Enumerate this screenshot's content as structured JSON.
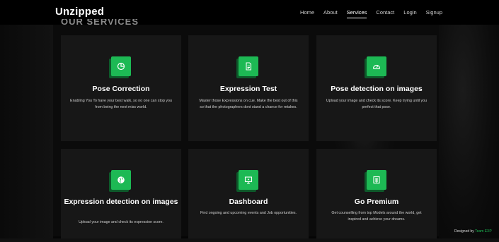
{
  "brand": "Unzipped",
  "nav": {
    "home": "Home",
    "about": "About",
    "services": "Services",
    "contact": "Contact",
    "login": "Login",
    "signup": "Signup"
  },
  "section_title": "OUR SERVICES",
  "cards": [
    {
      "title": "Pose Correction",
      "desc": "Enabling You To have your best walk, so no one can stop you from being the next miss world.",
      "icon": "chart-pie-icon"
    },
    {
      "title": "Expression Test",
      "desc": "Master those Expressions on cue. Make the best out of this so that the photographers dont stand a chance for retakes.",
      "icon": "document-icon"
    },
    {
      "title": "Pose detection on images",
      "desc": "Upload your image and check its score. Keep trying until you perfect that pose.",
      "icon": "gauge-icon"
    },
    {
      "title": "Expression detection on images",
      "desc": "Upload your image and check its expression score.",
      "icon": "globe-icon"
    },
    {
      "title": "Dashboard",
      "desc": "Find ongoing and upcoming events and Job opportunities.",
      "icon": "presentation-icon"
    },
    {
      "title": "Go Premium",
      "desc": "Get counselling from top Models around the world, get inspired and achieve your dreams.",
      "icon": "premium-icon"
    }
  ],
  "footer": {
    "designed_by": "Designed by",
    "team": "Team EXP"
  },
  "colors": {
    "accent": "#1db954",
    "card_bg": "#171717",
    "page_bg": "#050505"
  }
}
